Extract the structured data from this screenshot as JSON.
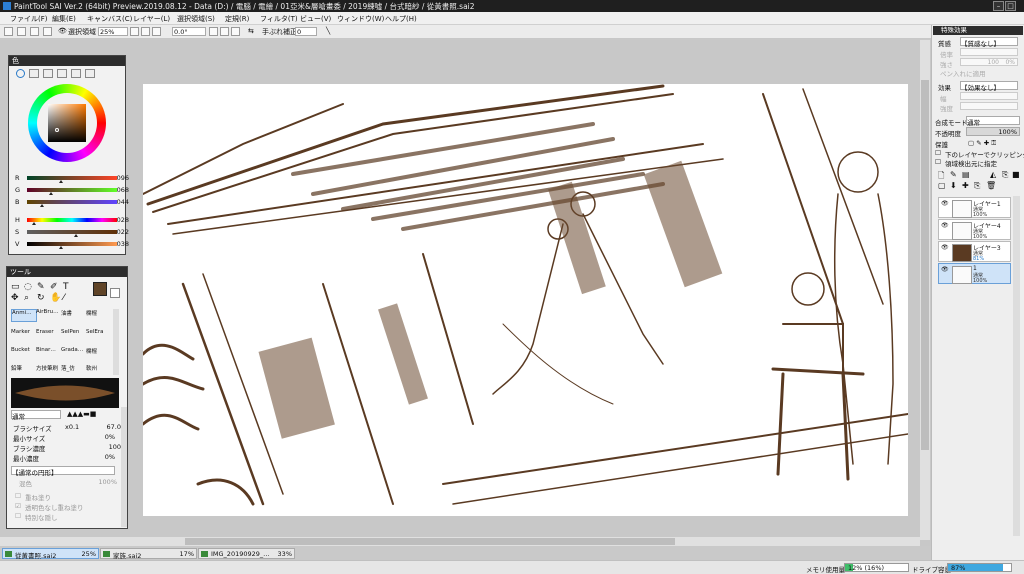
{
  "title": "PaintTool SAI Ver.2 (64bit) Preview.2019.08.12 - Data (D:) / 電腦 / 電繪 / 01亞米&層嗆畫委 / 2019練噓 / 台式暗紗 / 從黃書照.sai2",
  "menu": [
    "ファイル(F)",
    "編集(E)",
    "キャンバス(C)",
    "レイヤー(L)",
    "選択領域(S)",
    "定規(R)",
    "フィルタ(T)",
    "ビュー(V)",
    "ウィンドウ(W)",
    "ヘルプ(H)"
  ],
  "toolbar": {
    "select_label": "選択領域",
    "zoom": "25%",
    "angle": "0.0°",
    "stabilizer_label": "手ぶれ補正",
    "stabilizer_value": "0"
  },
  "color_panel": {
    "title": "色",
    "sliders": [
      {
        "label": "R",
        "value": "096",
        "fraction": 0.38
      },
      {
        "label": "G",
        "value": "068",
        "fraction": 0.27
      },
      {
        "label": "B",
        "value": "044",
        "fraction": 0.17
      },
      {
        "label": "H",
        "value": "028",
        "fraction": 0.08
      },
      {
        "label": "S",
        "value": "022",
        "fraction": 0.54
      },
      {
        "label": "V",
        "value": "038",
        "fraction": 0.38
      }
    ]
  },
  "tool_panel": {
    "title": "ツール",
    "tools": [
      "Anmi…",
      "AirBru…",
      "油書",
      "欄棍",
      "Marker",
      "Eraser",
      "SelPen",
      "SelEra",
      "Bucket",
      "Binar…",
      "Grada…",
      "欄棍",
      "鉛筆",
      "方技筆刷",
      "落_仿",
      "軟州"
    ],
    "blend_mode": "通常",
    "brush_size_label": "ブラシサイズ",
    "brush_size_mult": "x0.1",
    "brush_size_value": "67.0",
    "min_size_label": "最小サイズ",
    "min_size_value": "0%",
    "density_label": "ブラシ濃度",
    "density_value": "100",
    "min_density_label": "最小濃度",
    "min_density_value": "0%",
    "shape_label": "【通常の円形】",
    "blend_label": "混色",
    "blend_value": "100%",
    "check1": "重ね塗り",
    "check2": "透明色なし重ね塗り",
    "check3": "特別な隠し"
  },
  "right_panel": {
    "effects_title": "特殊効果",
    "paper_label": "質感",
    "paper_value": "【質感なし】",
    "scale_label": "倍率",
    "strength_label": "強さ",
    "strength_value": "100",
    "grain_label": "質感",
    "grain_percent": "0%",
    "invert_label": "ペン入れに適用",
    "effect_label": "効果",
    "effect_value": "【効果なし】",
    "width_label": "幅",
    "effect_strength_label": "強度",
    "blend_mode_label": "合成モード",
    "blend_mode_value": "通常",
    "opacity_label": "不透明度",
    "opacity_value": "100%",
    "protect_label": "保護",
    "clip_label": "下のレイヤーでクリッピング",
    "select_src_label": "領域検出元に指定"
  },
  "layers": [
    {
      "name": "レイヤー1",
      "mode": "通常",
      "opacity": "100%",
      "selected": false
    },
    {
      "name": "レイヤー4",
      "mode": "通常",
      "opacity": "100%",
      "selected": false
    },
    {
      "name": "レイヤー3",
      "mode": "通常",
      "opacity": "81%",
      "selected": false
    },
    {
      "name": "1",
      "mode": "通常",
      "opacity": "100%",
      "selected": true
    }
  ],
  "doc_tabs": [
    {
      "name": "從黃書照.sai2",
      "percent": "25%",
      "active": true
    },
    {
      "name": "家族.sai2",
      "percent": "17%",
      "active": false
    },
    {
      "name": "IMG_20190929_…",
      "percent": "33%",
      "active": false
    }
  ],
  "status": {
    "memory_label": "メモリ使用量",
    "memory_value": "12% (16%)",
    "memory_fraction": 0.12,
    "drive_label": "ドライブ容量",
    "drive_value": "87%",
    "drive_fraction": 0.87
  },
  "colors": {
    "current": "#604428",
    "sketch": "#5a3a22",
    "titlebar": "#1f1f1f",
    "selected_layer": "#cfe3f8"
  }
}
